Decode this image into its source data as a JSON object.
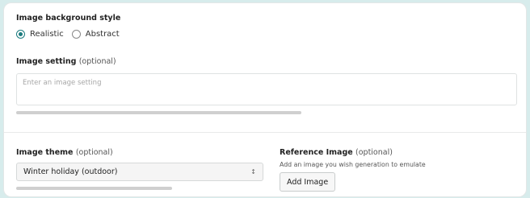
{
  "background_style": {
    "label": "Image background style",
    "options": [
      {
        "label": "Realistic",
        "selected": true
      },
      {
        "label": "Abstract",
        "selected": false
      }
    ]
  },
  "image_setting": {
    "label": "Image setting",
    "optional": "(optional)",
    "value": "",
    "placeholder": "Enter an image setting",
    "progress": 0.57
  },
  "image_theme": {
    "label": "Image theme",
    "optional": "(optional)",
    "selected": "Winter holiday (outdoor)",
    "progress": 0.63
  },
  "reference_image": {
    "label": "Reference Image",
    "optional": "(optional)",
    "helper": "Add an image you wish generation to emulate",
    "button_label": "Add Image"
  },
  "colors": {
    "accent": "#1b7b7e",
    "page_background": "#d7ecec"
  }
}
